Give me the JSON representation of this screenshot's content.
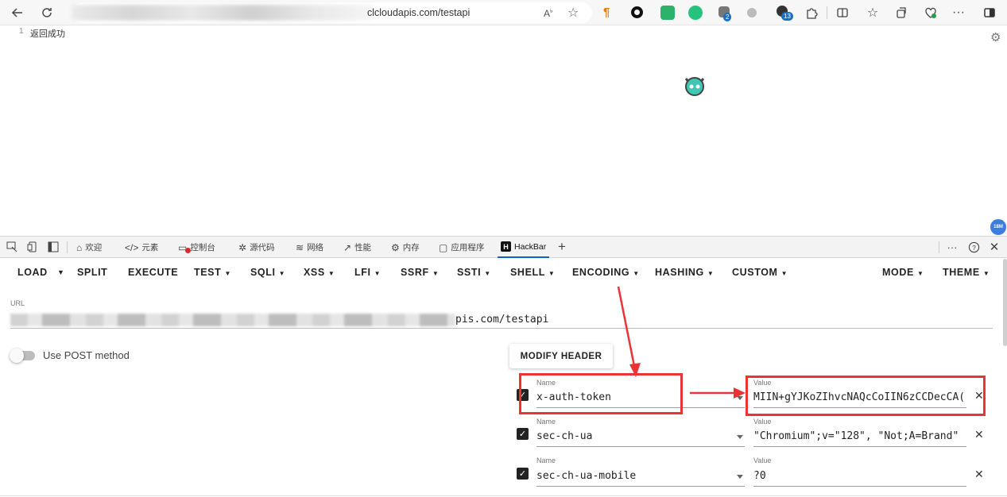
{
  "browser": {
    "url_visible_text": "clcloudapis.com/testapi",
    "read_aloud_label": "Aᴀ",
    "badges": {
      "ext_badge_a": "2",
      "ext_badge_b": "13"
    }
  },
  "page": {
    "line_number": "1",
    "content": "返回成功",
    "float_badge": "18M"
  },
  "devtools": {
    "tabs": [
      {
        "label": "欢迎",
        "icon": "home-icon"
      },
      {
        "label": "元素",
        "icon": "code-icon"
      },
      {
        "label": "控制台",
        "icon": "console-icon"
      },
      {
        "label": "源代码",
        "icon": "bug-icon"
      },
      {
        "label": "网络",
        "icon": "wifi-icon"
      },
      {
        "label": "性能",
        "icon": "performance-icon"
      },
      {
        "label": "内存",
        "icon": "memory-icon"
      },
      {
        "label": "应用程序",
        "icon": "app-icon"
      },
      {
        "label": "HackBar",
        "icon": "hackbar-logo-icon",
        "active": true
      }
    ],
    "hackbar_logo_letter": "H"
  },
  "hackbar": {
    "menu": {
      "load": "LOAD",
      "split": "SPLIT",
      "execute": "EXECUTE",
      "test": "TEST",
      "sqli": "SQLI",
      "xss": "XSS",
      "lfi": "LFI",
      "ssrf": "SSRF",
      "ssti": "SSTI",
      "shell": "SHELL",
      "encoding": "ENCODING",
      "hashing": "HASHING",
      "custom": "CUSTOM",
      "mode": "MODE",
      "theme": "THEME"
    },
    "url_label": "URL",
    "url_visible_text": "pis.com/testapi",
    "post_toggle_label": "Use POST method",
    "post_enabled": false,
    "modify_header_label": "MODIFY HEADER",
    "name_label": "Name",
    "value_label": "Value",
    "headers": [
      {
        "name": "x-auth-token",
        "value": "MIIN+gYJKoZIhvcNAQcCoIIN6zCCDecCA(",
        "checked": true
      },
      {
        "name": "sec-ch-ua",
        "value": "\"Chromium\";v=\"128\", \"Not;A=Brand\"",
        "checked": true
      },
      {
        "name": "sec-ch-ua-mobile",
        "value": "?0",
        "checked": true
      }
    ]
  },
  "colors": {
    "highlight_red": "#e83434",
    "active_tab": "#0b64c8"
  }
}
